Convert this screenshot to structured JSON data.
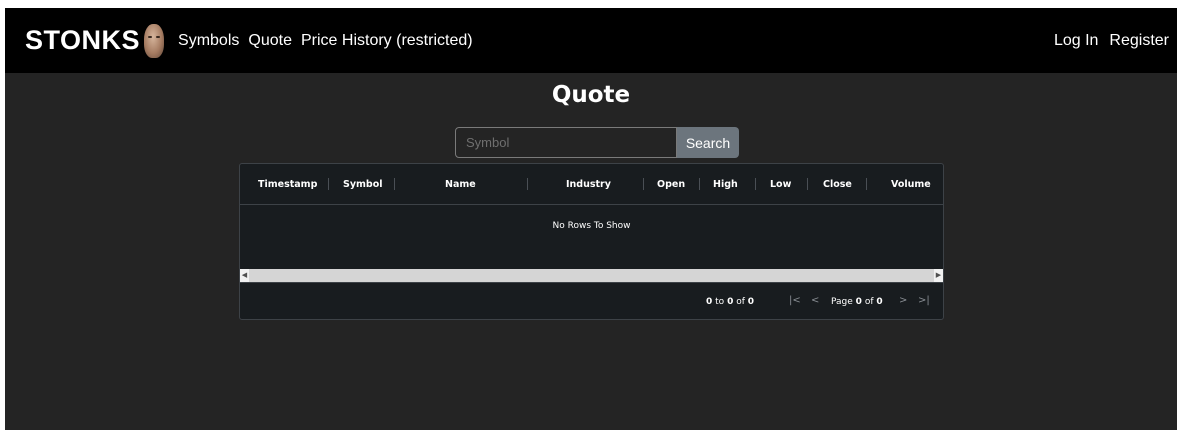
{
  "navbar": {
    "brand": "STONKS",
    "links": [
      "Symbols",
      "Quote",
      "Price History (restricted)"
    ],
    "right_links": [
      "Log In",
      "Register"
    ]
  },
  "page": {
    "title": "Quote"
  },
  "search": {
    "placeholder": "Symbol",
    "value": "",
    "button_label": "Search"
  },
  "grid": {
    "columns": [
      "Timestamp",
      "Symbol",
      "Name",
      "Industry",
      "Open",
      "High",
      "Low",
      "Close",
      "Volume"
    ],
    "no_rows_text": "No Rows To Show",
    "footer": {
      "from": "0",
      "to_word": "to",
      "to": "0",
      "of_word": "of",
      "total": "0",
      "page_word": "Page",
      "page": "0",
      "page_of_word": "of",
      "page_total": "0"
    }
  },
  "icons": {
    "first": "first-page-icon",
    "prev": "previous-page-icon",
    "next": "next-page-icon",
    "last": "last-page-icon"
  },
  "colors": {
    "background": "#242424",
    "navbar": "#000000",
    "grid_background": "#181c1f",
    "button": "#6c757d"
  }
}
